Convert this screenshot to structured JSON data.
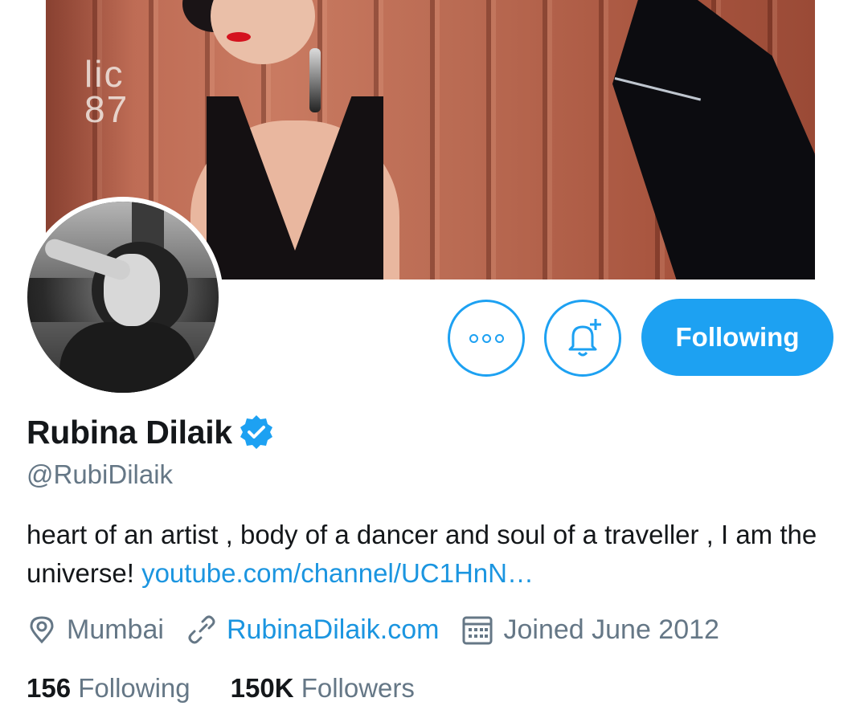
{
  "profile": {
    "display_name": "Rubina Dilaik",
    "handle": "@RubiDilaik",
    "verified": true,
    "bio_text": "heart of an artist , body of a dancer and soul of a traveller , I am the universe!",
    "bio_link": "youtube.com/channel/UC1HnN…",
    "location": "Mumbai",
    "website": "RubinaDilaik.com",
    "joined": "Joined June 2012"
  },
  "banner": {
    "container_code": "lic\n87"
  },
  "actions": {
    "follow_label": "Following"
  },
  "stats": {
    "following_count": "156",
    "following_label": "Following",
    "followers_count": "150K",
    "followers_label": "Followers"
  },
  "icons": {
    "more": "more-options-icon",
    "notify": "bell-plus-icon",
    "verified": "verified-badge-icon",
    "location": "location-pin-icon",
    "link": "link-icon",
    "calendar": "calendar-icon"
  },
  "colors": {
    "accent": "#1da1f2",
    "link": "#1b95e0",
    "secondary_text": "#657786",
    "primary_text": "#14171a"
  }
}
